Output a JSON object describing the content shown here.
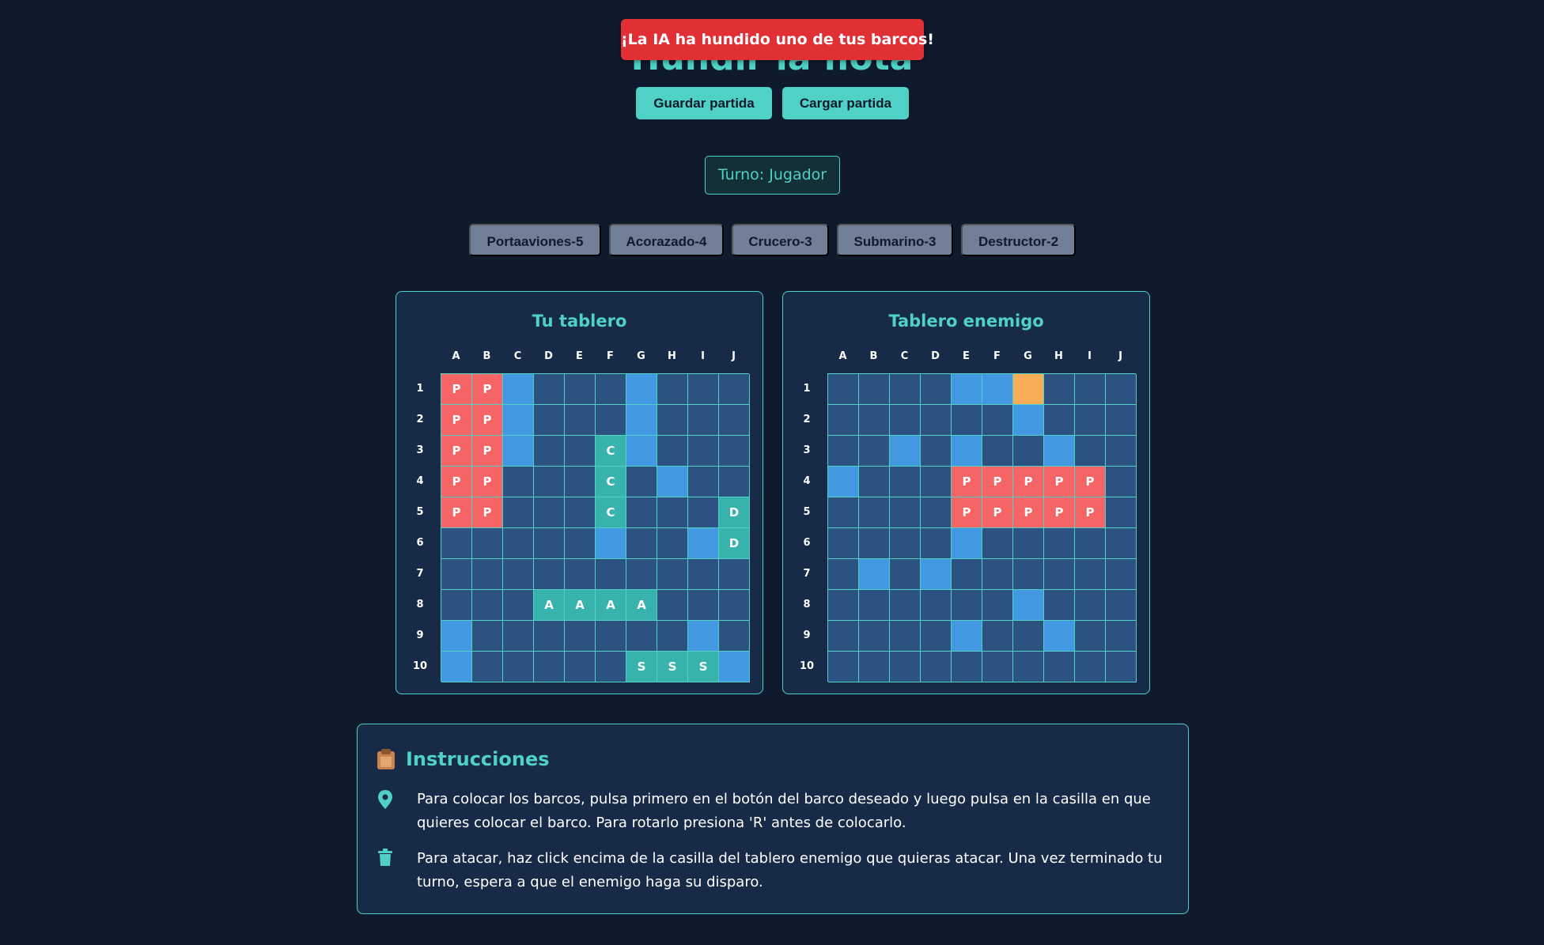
{
  "toast": "¡La IA ha hundido uno de tus barcos!",
  "title": "Hundir la flota",
  "buttons": {
    "save": "Guardar partida",
    "load": "Cargar partida"
  },
  "turn": "Turno: Jugador",
  "ships": [
    "Portaaviones-5",
    "Acorazado-4",
    "Crucero-3",
    "Submarino-3",
    "Destructor-2"
  ],
  "columns": [
    "A",
    "B",
    "C",
    "D",
    "E",
    "F",
    "G",
    "H",
    "I",
    "J"
  ],
  "rows": [
    "1",
    "2",
    "3",
    "4",
    "5",
    "6",
    "7",
    "8",
    "9",
    "10"
  ],
  "colors": {
    "accent": "#4fd1c5",
    "water": "#2c5282",
    "miss": "#4299e1",
    "carrier": "#f56565",
    "ship": "#38b2ac",
    "hit": "#f6ad55",
    "toast": "#e02f35"
  },
  "player_board": {
    "title": "Tu tablero",
    "legend": "grid rows 1-10; '.' = water, '~' = miss, letters = ships",
    "grid": [
      "PP~...~...",
      "PP~...~...",
      "PP~..C~...",
      "PP...C.~..",
      "PP...C...D",
      ".....~..~D",
      "..........",
      "...AAAA...",
      "~.......~.",
      "~.....SSS~"
    ]
  },
  "enemy_board": {
    "title": "Tablero enemigo",
    "grid": [
      "....~~*...",
      "......~...",
      "..~.~..~..",
      "~...PPPPP.",
      "....PPPPP.",
      "....~.....",
      ".~.~......",
      "......~...",
      "....~..~..",
      ".........."
    ]
  },
  "instructions": {
    "title": "Instrucciones",
    "title_icon": "clipboard-icon",
    "items": [
      {
        "icon": "map-pin-icon",
        "text": "Para colocar los barcos, pulsa primero en el botón del barco deseado y luego pulsa en la casilla en que quieres colocar el barco. Para rotarlo presiona 'R' antes de colocarlo."
      },
      {
        "icon": "trash-icon",
        "text": "Para atacar, haz click encima de la casilla del tablero enemigo que quieras atacar. Una vez terminado tu turno, espera a que el enemigo haga su disparo."
      }
    ]
  }
}
